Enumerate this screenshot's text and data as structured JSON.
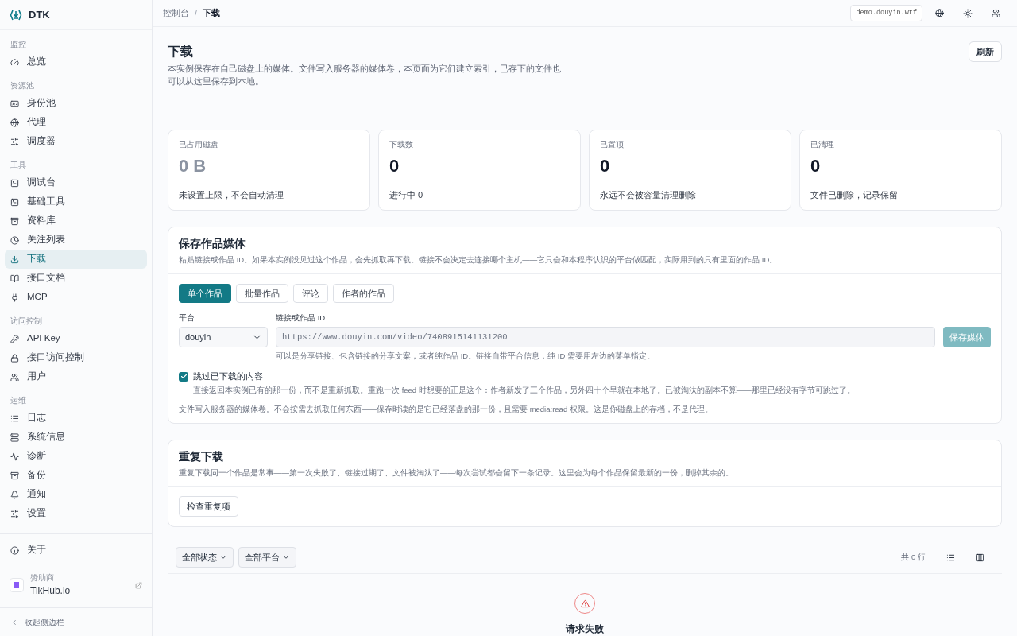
{
  "sidebar": {
    "brand": "DTK",
    "groups": [
      {
        "label": "监控",
        "items": [
          {
            "label": "总览",
            "selected": false
          }
        ]
      },
      {
        "label": "资源池",
        "items": [
          {
            "label": "身份池",
            "selected": false
          },
          {
            "label": "代理",
            "selected": false
          },
          {
            "label": "调度器",
            "selected": false
          }
        ]
      },
      {
        "label": "工具",
        "items": [
          {
            "label": "调试台",
            "selected": false
          },
          {
            "label": "基础工具",
            "selected": false
          },
          {
            "label": "资料库",
            "selected": false
          },
          {
            "label": "关注列表",
            "selected": false
          },
          {
            "label": "下载",
            "selected": true
          },
          {
            "label": "接口文档",
            "selected": false
          },
          {
            "label": "MCP",
            "selected": false
          }
        ]
      },
      {
        "label": "访问控制",
        "items": [
          {
            "label": "API Key",
            "selected": false
          },
          {
            "label": "接口访问控制",
            "selected": false
          },
          {
            "label": "用户",
            "selected": false
          }
        ]
      },
      {
        "label": "运维",
        "items": [
          {
            "label": "日志",
            "selected": false
          },
          {
            "label": "系统信息",
            "selected": false
          },
          {
            "label": "诊断",
            "selected": false
          },
          {
            "label": "备份",
            "selected": false
          },
          {
            "label": "通知",
            "selected": false
          },
          {
            "label": "设置",
            "selected": false
          }
        ]
      }
    ],
    "about": "关于",
    "sponsor_label": "赞助商",
    "sponsor_name": "TikHub.io",
    "collapse": "收起侧边栏"
  },
  "topbar": {
    "breadcrumb": [
      "控制台",
      "下载"
    ],
    "separator": "/",
    "host": "demo.douyin.wtf"
  },
  "header": {
    "title": "下载",
    "description": "本实例保存在自己磁盘上的媒体。文件写入服务器的媒体卷，本页面为它们建立索引，已存下的文件也可以从这里保存到本地。",
    "refresh": "刷新"
  },
  "stats": [
    {
      "label": "已占用磁盘",
      "value": "0 B",
      "muted": true,
      "note": "未设置上限，不会自动清理"
    },
    {
      "label": "下载数",
      "value": "0",
      "muted": false,
      "note": "进行中 0"
    },
    {
      "label": "已置顶",
      "value": "0",
      "muted": false,
      "note": "永远不会被容量清理删除"
    },
    {
      "label": "已清理",
      "value": "0",
      "muted": false,
      "note": "文件已删除，记录保留"
    }
  ],
  "save_card": {
    "title": "保存作品媒体",
    "description": "粘贴链接或作品 ID。如果本实例没见过这个作品，会先抓取再下载。链接不会决定去连接哪个主机——它只会和本程序认识的平台做匹配，实际用到的只有里面的作品 ID。",
    "tabs": [
      {
        "label": "单个作品",
        "selected": true
      },
      {
        "label": "批量作品",
        "selected": false
      },
      {
        "label": "评论",
        "selected": false
      },
      {
        "label": "作者的作品",
        "selected": false
      }
    ],
    "platform_label": "平台",
    "platform_value": "douyin",
    "link_label": "链接或作品 ID",
    "link_placeholder": "https://www.douyin.com/video/7408915141131200",
    "link_hint": "可以是分享链接、包含链接的分享文案，或者纯作品 ID。链接自带平台信息；纯 ID 需要用左边的菜单指定。",
    "save_button": {
      "label": "保存媒体",
      "disabled": true
    },
    "skip": {
      "label": "跳过已下载的内容",
      "checked": true,
      "description": "直接返回本实例已有的那一份，而不是重新抓取。重跑一次 feed 时想要的正是这个：作者新发了三个作品，另外四十个早就在本地了。已被淘汰的副本不算——那里已经没有字节可跳过了。"
    },
    "footnote": "文件写入服务器的媒体卷。不会按需去抓取任何东西——保存时读的是它已经落盘的那一份，且需要 media:read 权限。这是你磁盘上的存档，不是代理。"
  },
  "dup_card": {
    "title": "重复下载",
    "description": "重复下载同一个作品是常事——第一次失败了、链接过期了、文件被淘汰了——每次尝试都会留下一条记录。这里会为每个作品保留最新的一份，删掉其余的。",
    "button": "检查重复项"
  },
  "toolbar": {
    "filters": [
      "全部状态",
      "全部平台"
    ],
    "count": "共 0 行"
  },
  "error": {
    "message": "请求失败"
  }
}
